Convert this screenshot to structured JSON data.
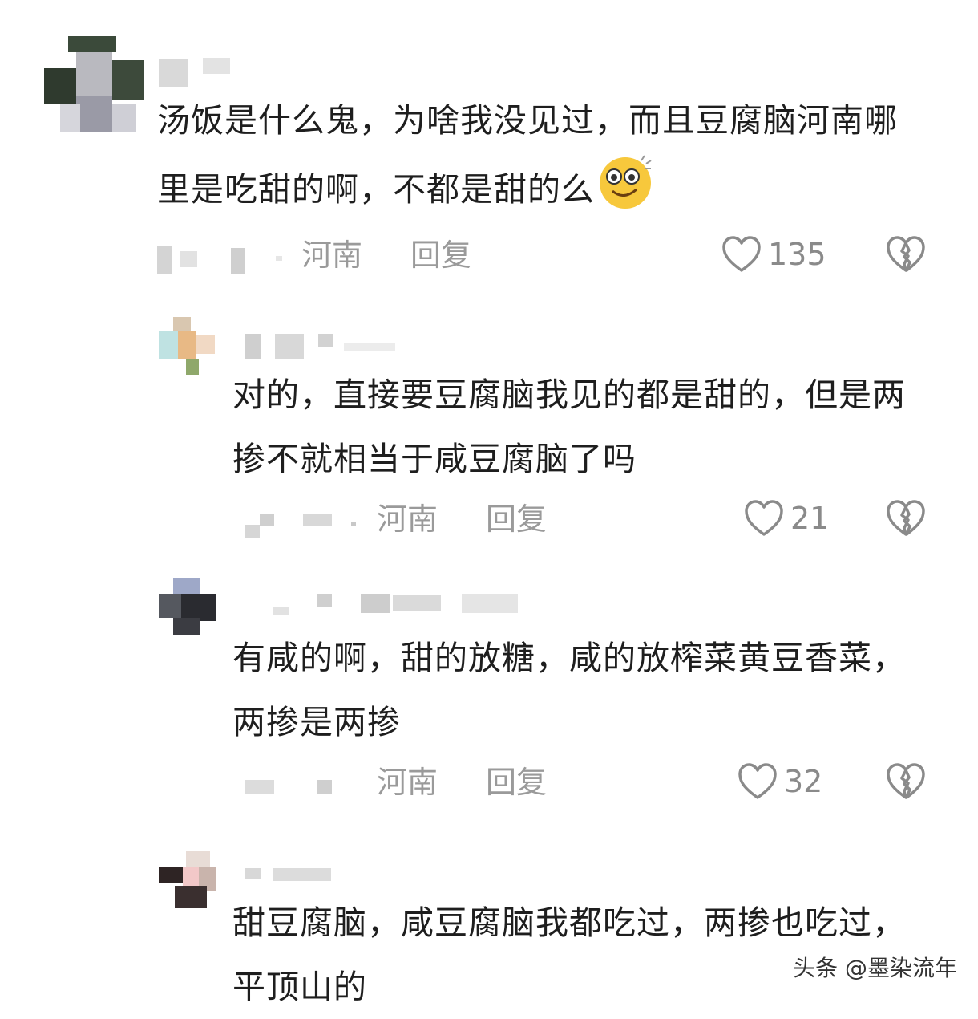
{
  "comments": [
    {
      "text": "汤饭是什么鬼，为啥我没见过，而且豆腐脑河南哪里是吃甜的啊，不都是甜的么",
      "emoji": "smiling-face-emoji",
      "location": "河南",
      "reply_label": "回复",
      "likes": "135"
    },
    {
      "text": "对的，直接要豆腐脑我见的都是甜的，但是两掺不就相当于咸豆腐脑了吗",
      "location": "河南",
      "reply_label": "回复",
      "likes": "21"
    },
    {
      "text": "有咸的啊，甜的放糖，咸的放榨菜黄豆香菜，两掺是两掺",
      "location": "河南",
      "reply_label": "回复",
      "likes": "32"
    },
    {
      "text": "甜豆腐脑，咸豆腐脑我都吃过，两掺也吃过，平顶山的"
    }
  ],
  "watermark": "头条 @墨染流年",
  "icons": {
    "like": "heart-outline-icon",
    "dislike": "broken-heart-icon"
  },
  "colors": {
    "text": "#1e1e1e",
    "meta": "#9a9a9a",
    "icon": "#8a8a8a"
  }
}
